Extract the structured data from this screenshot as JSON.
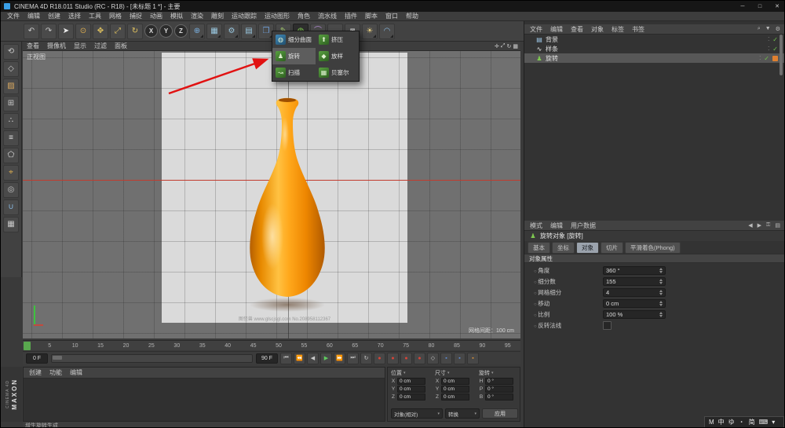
{
  "window": {
    "title": "CINEMA 4D R18.011 Studio (RC - R18) - [未标题 1 *] - 主要",
    "min": "─",
    "max": "□",
    "close": "✕"
  },
  "menubar": [
    "文件",
    "编辑",
    "创建",
    "选择",
    "工具",
    "网格",
    "捕捉",
    "动画",
    "模拟",
    "渲染",
    "雕刻",
    "运动跟踪",
    "运动图形",
    "角色",
    "流水线",
    "插件",
    "脚本",
    "窗口",
    "帮助"
  ],
  "toolbar": {
    "icons_left": [
      {
        "name": "undo-icon",
        "glyph": "↶",
        "color": "#c8c8c8"
      },
      {
        "name": "redo-icon",
        "glyph": "↷",
        "color": "#c8c8c8"
      },
      {
        "name": "cursor-tool-icon",
        "glyph": "➤",
        "color": "#ececec"
      },
      {
        "name": "live-selection-icon",
        "glyph": "⊙",
        "color": "#e0b050"
      },
      {
        "name": "move-tool-icon",
        "glyph": "✥",
        "color": "#e3c45f"
      },
      {
        "name": "scale-tool-icon",
        "glyph": "⤢",
        "color": "#e3c45f"
      },
      {
        "name": "rotate-tool-icon",
        "glyph": "↻",
        "color": "#e3c45f"
      }
    ],
    "axis": [
      "X",
      "Y",
      "Z"
    ],
    "icons_mid": [
      {
        "name": "coordinate-system-icon",
        "glyph": "⊕",
        "color": "#7ab0e0"
      },
      {
        "name": "render-view-icon",
        "glyph": "▦",
        "color": "#9ac8e0"
      },
      {
        "name": "render-settings-icon",
        "glyph": "⚙",
        "color": "#9ac8e0"
      },
      {
        "name": "render-queue-icon",
        "glyph": "▤",
        "color": "#9ac8e0"
      },
      {
        "name": "cube-primitive-icon",
        "glyph": "❒",
        "color": "#6f9fd8"
      },
      {
        "name": "pen-spline-icon",
        "glyph": "✎",
        "color": "#a8d070"
      }
    ],
    "subdiv": {
      "glyph": "◍"
    },
    "icons_end": [
      {
        "name": "bend-deformer-icon",
        "glyph": "⌒",
        "color": "#b08ad0"
      },
      {
        "name": "floor-icon",
        "glyph": "▬",
        "color": "#b8b8b8"
      },
      {
        "name": "camera-icon",
        "glyph": "◙",
        "color": "#b8b8b8"
      },
      {
        "name": "light-icon",
        "glyph": "☀",
        "color": "#e8d080"
      },
      {
        "name": "sky-icon",
        "glyph": "◠",
        "color": "#88b8e0"
      }
    ]
  },
  "left_toolbar": {
    "icons": [
      {
        "name": "make-editable-icon",
        "glyph": "⟲",
        "color": "#c8c8c8"
      },
      {
        "name": "model-mode-icon",
        "glyph": "◇",
        "color": "#c8c8c8"
      },
      {
        "name": "texture-mode-icon",
        "glyph": "▨",
        "color": "#d8a860"
      },
      {
        "name": "workplane-mode-icon",
        "glyph": "⊞",
        "color": "#c8c8c8"
      },
      {
        "name": "points-mode-icon",
        "glyph": "∴",
        "color": "#e0e0e0"
      },
      {
        "name": "edges-mode-icon",
        "glyph": "≡",
        "color": "#e0e0e0"
      },
      {
        "name": "polygons-mode-icon",
        "glyph": "⬠",
        "color": "#e0e0e0"
      },
      {
        "name": "enable-axis-icon",
        "glyph": "⌖",
        "color": "#e0b050"
      },
      {
        "name": "solo-view-icon",
        "glyph": "◎",
        "color": "#c8c8c8"
      },
      {
        "name": "enable-snap-icon",
        "glyph": "∪",
        "color": "#88b8e0"
      },
      {
        "name": "locked-workplane-icon",
        "glyph": "▦",
        "color": "#c8c8c8"
      }
    ]
  },
  "generator_menu": {
    "items": [
      {
        "label": "细分曲面",
        "icon": "◍"
      },
      {
        "label": "挤压",
        "icon": "⬆"
      },
      {
        "label": "旋转",
        "icon": "♟"
      },
      {
        "label": "放样",
        "icon": "◆"
      },
      {
        "label": "扫描",
        "icon": "↝"
      },
      {
        "label": "贝塞尔",
        "icon": "▦"
      }
    ]
  },
  "viewport": {
    "menu": [
      "查看",
      "摄像机",
      "显示",
      "过滤",
      "面板"
    ],
    "corner_icons": [
      {
        "name": "pan-view-icon",
        "glyph": "✛"
      },
      {
        "name": "zoom-view-icon",
        "glyph": "⤢"
      },
      {
        "name": "rotate-view-icon",
        "glyph": "↻"
      },
      {
        "name": "maximize-view-icon",
        "glyph": "▦"
      }
    ],
    "view_label": "正视图",
    "grid_spacing": "网格间距：100 cm",
    "watermark": "图怪兽 www.glscjsgl.com No.208958112367"
  },
  "object_manager": {
    "menu": [
      "文件",
      "编辑",
      "查看",
      "对象",
      "标签",
      "书签"
    ],
    "header_icons": [
      {
        "name": "search-icon",
        "glyph": "⌕"
      },
      {
        "name": "filter-icon",
        "glyph": "▼"
      },
      {
        "name": "gear-icon",
        "glyph": "⚙"
      }
    ],
    "dots_glyph": "⁚",
    "check_glyph": "✓",
    "objects": [
      {
        "name": "背景",
        "icon": "▤"
      },
      {
        "name": "样条",
        "icon": "∿"
      },
      {
        "name": "旋转",
        "icon": "♟"
      }
    ]
  },
  "attributes": {
    "menu": [
      "模式",
      "编辑",
      "用户数据"
    ],
    "header_icons": [
      {
        "name": "back-icon",
        "glyph": "◀"
      },
      {
        "name": "forward-icon",
        "glyph": "▶"
      },
      {
        "name": "lock-icon",
        "glyph": "⚿"
      },
      {
        "name": "panel-icon",
        "glyph": "▤"
      }
    ],
    "title": "旋转对象 [旋转]",
    "title_icon": "♟",
    "tabs": [
      "基本",
      "坐标",
      "对象",
      "切片",
      "平滑着色(Phong)"
    ],
    "section": "对象属性",
    "props": [
      {
        "label": "角度",
        "value": "360 °"
      },
      {
        "label": "细分数",
        "value": "155"
      },
      {
        "label": "网格细分",
        "value": "4"
      },
      {
        "label": "移动",
        "value": "0 cm"
      },
      {
        "label": "比例",
        "value": "100 %"
      }
    ],
    "invert_normals": "反转法线"
  },
  "timeline": {
    "ticks": [
      "5",
      "10",
      "15",
      "20",
      "25",
      "30",
      "35",
      "40",
      "45",
      "50",
      "55",
      "60",
      "65",
      "70",
      "75",
      "80",
      "85",
      "90",
      "95"
    ],
    "current": "0 F",
    "end": "90 F"
  },
  "transport": {
    "buttons": [
      {
        "name": "goto-start-icon",
        "glyph": "⏮",
        "color": "#c8c8c8"
      },
      {
        "name": "prev-key-icon",
        "glyph": "⏪",
        "color": "#c8c8c8"
      },
      {
        "name": "prev-frame-icon",
        "glyph": "◀",
        "color": "#c8c8c8"
      },
      {
        "name": "play-icon",
        "glyph": "▶",
        "color": "#5fca5f"
      },
      {
        "name": "next-frame-icon",
        "glyph": "⏩",
        "color": "#c8c8c8"
      },
      {
        "name": "goto-end-icon",
        "glyph": "⏭",
        "color": "#c8c8c8"
      },
      {
        "name": "loop-icon",
        "glyph": "↻",
        "color": "#c8c8c8"
      },
      {
        "name": "record-keyframe-icon",
        "glyph": "●",
        "color": "#d84438"
      },
      {
        "name": "autokey-icon",
        "glyph": "●",
        "color": "#d84438"
      },
      {
        "name": "record-position-icon",
        "glyph": "●",
        "color": "#d84438"
      },
      {
        "name": "record-rotation-icon",
        "glyph": "●",
        "color": "#d84438"
      },
      {
        "name": "point-level-animation-icon",
        "glyph": "◇",
        "color": "#c8c8c8"
      },
      {
        "name": "keyframe-selection-icon",
        "glyph": "▪",
        "color": "#5f8fd8"
      },
      {
        "name": "keying-settings-icon",
        "glyph": "▪",
        "color": "#5f8fd8"
      },
      {
        "name": "timeline-options-icon",
        "glyph": "▪",
        "color": "#d8913a"
      }
    ]
  },
  "materials": {
    "menu": [
      "创建",
      "功能",
      "编辑"
    ]
  },
  "coords": {
    "headers": [
      "位置",
      "尺寸",
      "旋转"
    ],
    "chevron": "▾",
    "pos": {
      "x_label": "X",
      "x": "0 cm",
      "y_label": "Y",
      "y": "0 cm",
      "z_label": "Z",
      "z": "0 cm"
    },
    "size": {
      "x_label": "X",
      "x": "0 cm",
      "y_label": "Y",
      "y": "0 cm",
      "z_label": "Z",
      "z": "0 cm"
    },
    "rot": {
      "h_label": "H",
      "h": "0 °",
      "p_label": "P",
      "p": "0 °",
      "b_label": "B",
      "b": "0 °"
    },
    "mode": "对象(相对)",
    "transfer": "转换",
    "apply": "应用"
  },
  "logo": {
    "brand": "MAXON",
    "product": "CINEMA 4D"
  },
  "statusbar": {
    "text": "增生旋转生成"
  },
  "ime": {
    "items": [
      {
        "name": "ime-logo",
        "glyph": "M"
      },
      {
        "name": "ime-lang",
        "glyph": "中"
      },
      {
        "name": "ime-mode",
        "glyph": "ゆ"
      },
      {
        "name": "ime-dot",
        "glyph": "・"
      },
      {
        "name": "ime-simplified",
        "glyph": "简"
      },
      {
        "name": "ime-keyboard-icon",
        "glyph": "⌨"
      },
      {
        "name": "ime-more-icon",
        "glyph": "▾"
      }
    ]
  },
  "colors": {
    "vase_primary": "#ffa81c",
    "vase_dark": "#b05a00",
    "axis_red": "#c23b2e",
    "generator_green": "#7ec850",
    "arrow_red": "#e11212"
  }
}
